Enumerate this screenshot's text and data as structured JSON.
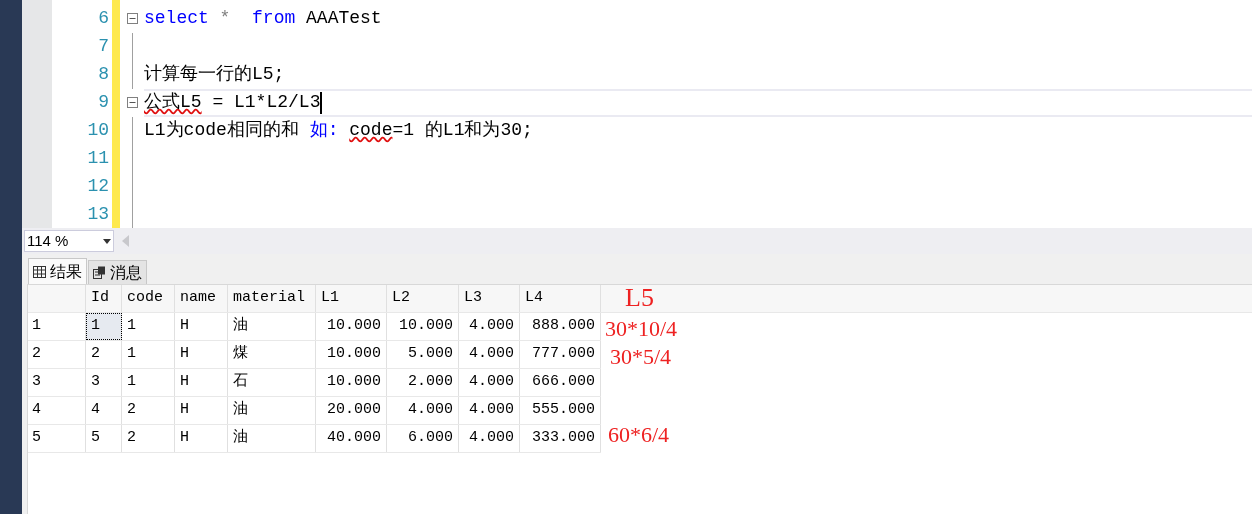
{
  "editor": {
    "lines": [
      {
        "number": "6",
        "fold": true,
        "current": false,
        "segments": [
          {
            "text": "select",
            "kind": "keyword"
          },
          {
            "text": " *  ",
            "kind": "operator"
          },
          {
            "text": "from",
            "kind": "keyword"
          },
          {
            "text": " AAATest",
            "kind": "plain"
          }
        ]
      },
      {
        "number": "7",
        "fold": false,
        "current": false
      },
      {
        "number": "8",
        "fold": false,
        "current": false,
        "segments": [
          {
            "text": "计算每一行的L5;",
            "kind": "plain"
          }
        ]
      },
      {
        "number": "9",
        "fold": true,
        "current": true,
        "segments": [
          {
            "text": "公式L5",
            "kind": "error"
          },
          {
            "text": " = L1*L2/L3",
            "kind": "plain"
          }
        ]
      },
      {
        "number": "10",
        "fold": false,
        "current": false,
        "segments": [
          {
            "text": "L1为code相同的和 ",
            "kind": "plain"
          },
          {
            "text": "如: ",
            "kind": "keyword"
          },
          {
            "text": "code",
            "kind": "error"
          },
          {
            "text": "=1 的L1和为30;",
            "kind": "plain"
          }
        ]
      },
      {
        "number": "11",
        "fold": false,
        "current": false
      },
      {
        "number": "12",
        "fold": false,
        "current": false
      },
      {
        "number": "13",
        "fold": false,
        "current": false
      }
    ]
  },
  "zoom": {
    "value": "114 %"
  },
  "tabs": [
    {
      "label": "结果",
      "selected": true
    },
    {
      "label": "消息",
      "selected": false
    }
  ],
  "table": {
    "columns": [
      "Id",
      "code",
      "name",
      "material",
      "L1",
      "L2",
      "L3",
      "L4"
    ],
    "rows": [
      {
        "row_number": "1",
        "cells": [
          "1",
          "1",
          "H",
          "油",
          "10.000",
          "10.000",
          "4.000",
          "888.000"
        ],
        "focused": true
      },
      {
        "row_number": "2",
        "cells": [
          "2",
          "1",
          "H",
          "煤",
          "10.000",
          "5.000",
          "4.000",
          "777.000"
        ],
        "focused": false
      },
      {
        "row_number": "3",
        "cells": [
          "3",
          "1",
          "H",
          "石",
          "10.000",
          "2.000",
          "4.000",
          "666.000"
        ],
        "focused": false
      },
      {
        "row_number": "4",
        "cells": [
          "4",
          "2",
          "H",
          "油",
          "20.000",
          "4.000",
          "4.000",
          "555.000"
        ],
        "focused": false
      },
      {
        "row_number": "5",
        "cells": [
          "5",
          "2",
          "H",
          "油",
          "40.000",
          "6.000",
          "4.000",
          "333.000"
        ],
        "focused": false
      }
    ]
  },
  "annotations": [
    "L5",
    "30*10/4",
    "30*5/4",
    "60*6/4"
  ]
}
